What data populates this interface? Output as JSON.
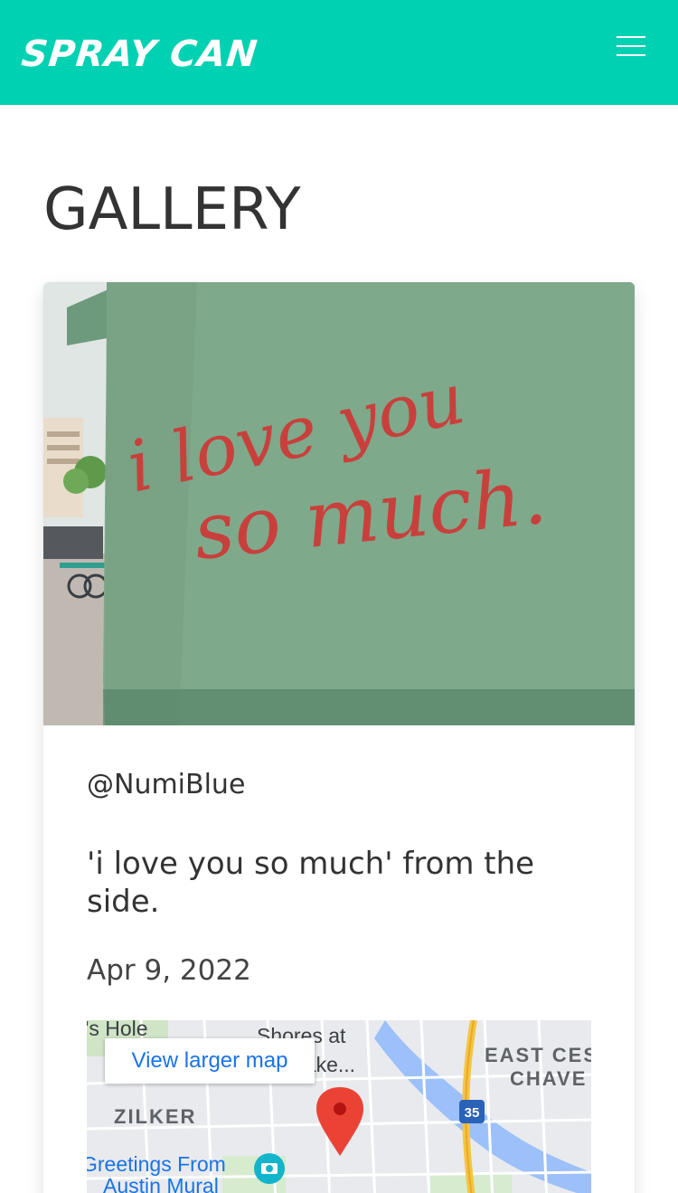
{
  "navbar": {
    "brand": "SPRAY CAN",
    "menu_icon": "hamburger-menu-icon"
  },
  "page": {
    "title": "GALLERY"
  },
  "post": {
    "image_text_line1": "i love you",
    "image_text_line2": "so much.",
    "author": "@NumiBlue",
    "caption": "'i love you so much' from the side.",
    "date": "Apr 9, 2022"
  },
  "map": {
    "view_larger_label": "View larger map",
    "labels": {
      "top_left": "'s Hole",
      "shores": "Shores at",
      "lake": "Lake...",
      "east_1": "EAST CES",
      "east_2": "CHAVE",
      "zilker": "ZILKER",
      "greetings_1": "Greetings From",
      "greetings_2": "Austin Mural",
      "highway": "35"
    },
    "pin_icon": "map-pin-icon",
    "camera_icon": "camera-icon"
  },
  "colors": {
    "navbar": "#00d1b2",
    "wall": "#7fa98b",
    "graffiti": "#c8403c",
    "map_water": "#9cc0f9",
    "map_pin": "#ea4335"
  }
}
